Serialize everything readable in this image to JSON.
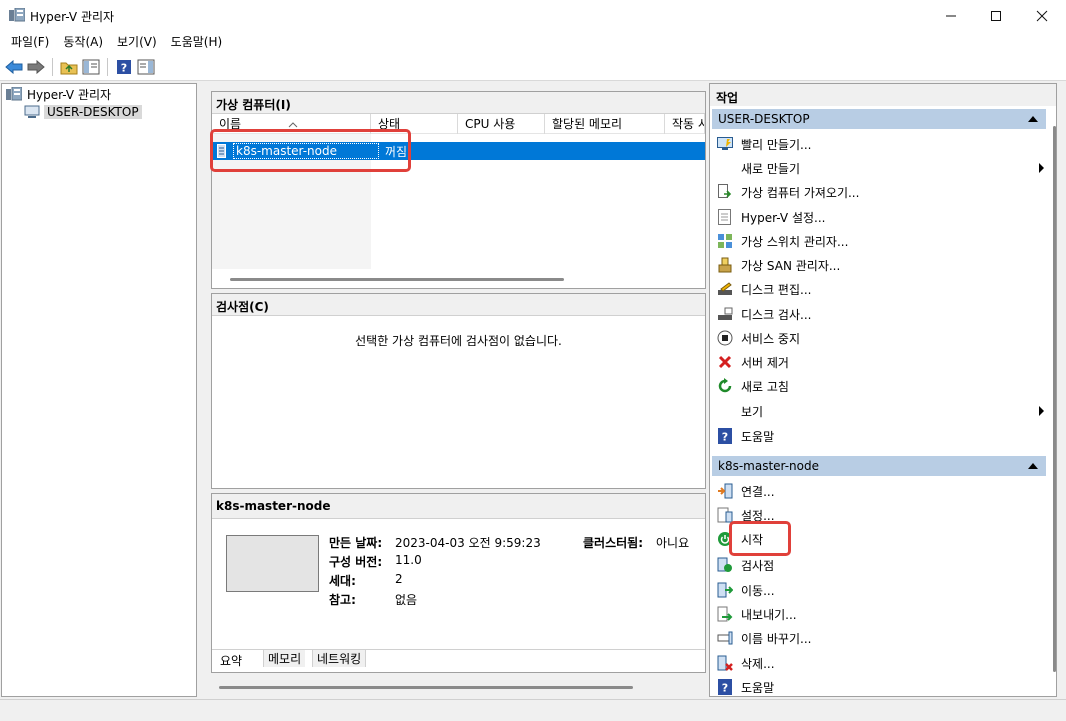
{
  "window": {
    "title": "Hyper-V 관리자"
  },
  "menu": [
    "파일(F)",
    "동작(A)",
    "보기(V)",
    "도움말(H)"
  ],
  "tree": {
    "root": "Hyper-V 관리자",
    "host": "USER-DESKTOP"
  },
  "vm_panel": {
    "title": "가상 컴퓨터(I)",
    "columns": [
      "이름",
      "상태",
      "CPU 사용",
      "할당된 메모리",
      "작동 시"
    ],
    "rows": [
      {
        "name": "k8s-master-node",
        "state": "꺼짐"
      }
    ]
  },
  "checkpoint_panel": {
    "title": "검사점(C)",
    "empty_message": "선택한 가상 컴퓨터에 검사점이 없습니다."
  },
  "details_panel": {
    "title": "k8s-master-node",
    "created_label": "만든 날짜:",
    "created_value": "2023-04-03 오전 9:59:23",
    "config_label": "구성 버전:",
    "config_value": "11.0",
    "gen_label": "세대:",
    "gen_value": "2",
    "notes_label": "참고:",
    "notes_value": "없음",
    "cluster_label": "클러스터됨:",
    "cluster_value": "아니요",
    "tabs": [
      "요약",
      "메모리",
      "네트워킹"
    ]
  },
  "actions": {
    "title": "작업",
    "host_group": "USER-DESKTOP",
    "host_items": [
      {
        "label": "빨리 만들기...",
        "icon": "quick-create-icon"
      },
      {
        "label": "새로 만들기",
        "icon": "",
        "submenu": true
      },
      {
        "label": "가상 컴퓨터 가져오기...",
        "icon": "import-vm-icon"
      },
      {
        "label": "Hyper-V 설정...",
        "icon": "settings-doc-icon"
      },
      {
        "label": "가상 스위치 관리자...",
        "icon": "switch-manager-icon"
      },
      {
        "label": "가상 SAN 관리자...",
        "icon": "san-manager-icon"
      },
      {
        "label": "디스크 편집...",
        "icon": "edit-disk-icon"
      },
      {
        "label": "디스크 검사...",
        "icon": "inspect-disk-icon"
      },
      {
        "label": "서비스 중지",
        "icon": "stop-service-icon"
      },
      {
        "label": "서버 제거",
        "icon": "remove-server-icon"
      },
      {
        "label": "새로 고침",
        "icon": "refresh-icon"
      },
      {
        "label": "보기",
        "icon": "",
        "submenu": true
      },
      {
        "label": "도움말",
        "icon": "help-icon"
      }
    ],
    "vm_group": "k8s-master-node",
    "vm_items": [
      {
        "label": "연결...",
        "icon": "connect-icon"
      },
      {
        "label": "설정...",
        "icon": "vm-settings-icon"
      },
      {
        "label": "시작",
        "icon": "start-icon"
      },
      {
        "label": "검사점",
        "icon": "checkpoint-icon"
      },
      {
        "label": "이동...",
        "icon": "move-icon"
      },
      {
        "label": "내보내기...",
        "icon": "export-icon"
      },
      {
        "label": "이름 바꾸기...",
        "icon": "rename-icon"
      },
      {
        "label": "삭제...",
        "icon": "delete-icon"
      },
      {
        "label": "도움말",
        "icon": "help-icon"
      }
    ]
  },
  "colors": {
    "selection": "#0078d7",
    "group_header": "#b8cde4",
    "highlight": "#e0403a"
  }
}
